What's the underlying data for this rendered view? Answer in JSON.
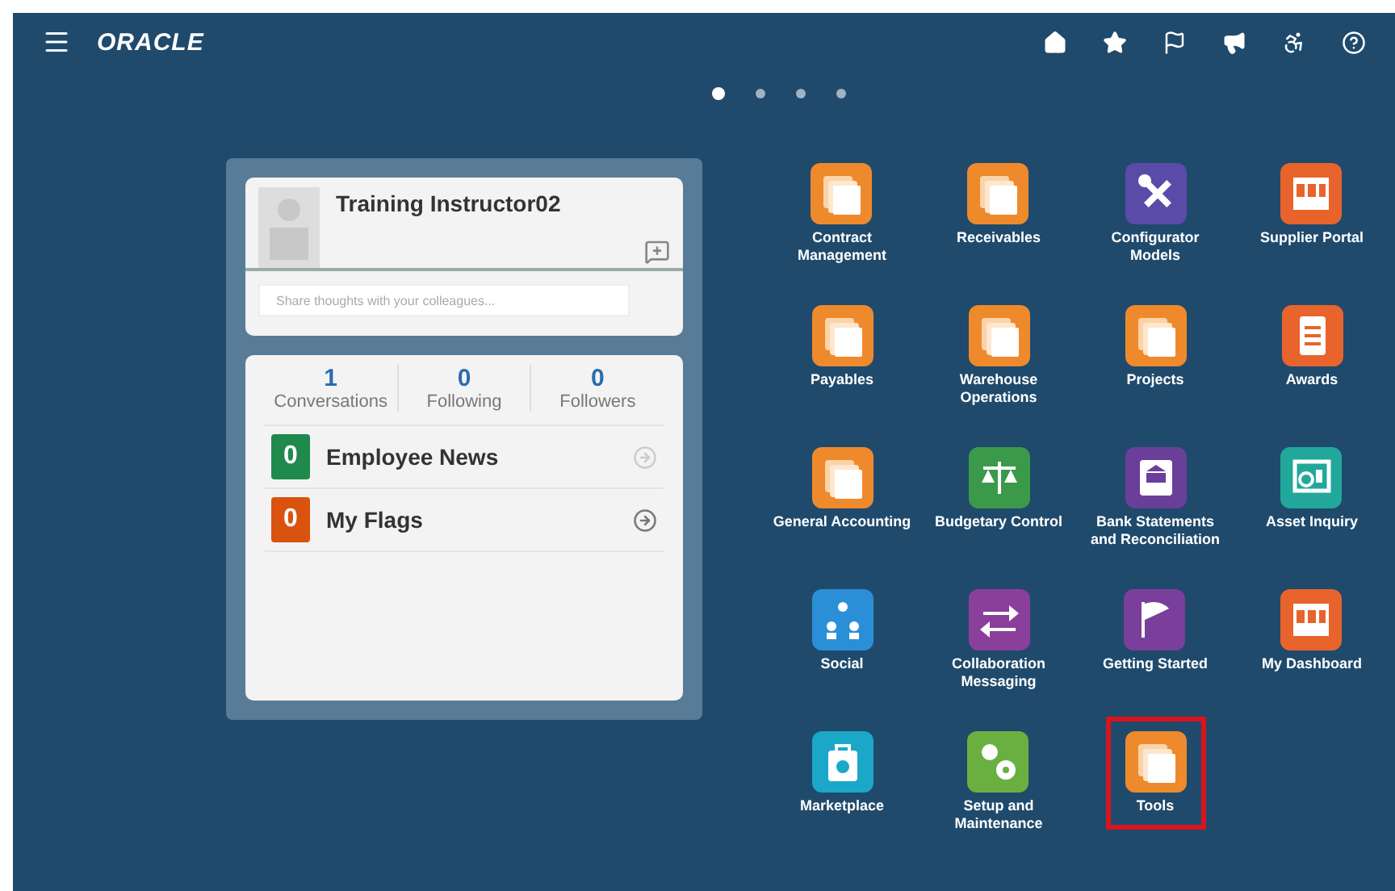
{
  "header": {
    "logo": "ORACLE"
  },
  "page_dots": [
    {
      "selected": true
    },
    {
      "selected": false
    },
    {
      "selected": false
    },
    {
      "selected": false
    }
  ],
  "profile": {
    "name": "Training Instructor02",
    "placeholder": "Share thoughts with your colleagues..."
  },
  "stats": [
    {
      "value": "1",
      "label": "Conversations"
    },
    {
      "value": "0",
      "label": "Following"
    },
    {
      "value": "0",
      "label": "Followers"
    }
  ],
  "feeds": [
    {
      "count": "0",
      "label": "Employee News",
      "color": "#1f8a4c",
      "disabled": true
    },
    {
      "count": "0",
      "label": "My Flags",
      "color": "#d9530f",
      "disabled": false
    }
  ],
  "apps": [
    {
      "label": "Contract\nManagement",
      "kind": "stack",
      "color": "#ee8a2c",
      "highlighted": false
    },
    {
      "label": "Receivables",
      "kind": "stack",
      "color": "#ee8a2c",
      "highlighted": false
    },
    {
      "label": "Configurator\nModels",
      "kind": "tools",
      "color": "#5b4ba8",
      "highlighted": false
    },
    {
      "label": "Supplier Portal",
      "kind": "dashboard",
      "color": "#e8642c",
      "highlighted": false
    },
    {
      "label": "Payables",
      "kind": "stack",
      "color": "#ee8a2c",
      "highlighted": false
    },
    {
      "label": "Warehouse\nOperations",
      "kind": "stack",
      "color": "#ee8a2c",
      "highlighted": false
    },
    {
      "label": "Projects",
      "kind": "stack",
      "color": "#ee8a2c",
      "highlighted": false
    },
    {
      "label": "Awards",
      "kind": "awards",
      "color": "#e8642c",
      "highlighted": false
    },
    {
      "label": "General Accounting",
      "kind": "stack",
      "color": "#ee8a2c",
      "highlighted": false
    },
    {
      "label": "Budgetary Control",
      "kind": "scales",
      "color": "#3a9a4a",
      "highlighted": false
    },
    {
      "label": "Bank Statements\nand Reconciliation",
      "kind": "bank",
      "color": "#6a3f9a",
      "highlighted": false
    },
    {
      "label": "Asset Inquiry",
      "kind": "inquiry",
      "color": "#21a89a",
      "highlighted": false
    },
    {
      "label": "Social",
      "kind": "social",
      "color": "#2b8fd8",
      "highlighted": false
    },
    {
      "label": "Collaboration\nMessaging",
      "kind": "arrows",
      "color": "#8a3f9a",
      "highlighted": false
    },
    {
      "label": "Getting Started",
      "kind": "flag",
      "color": "#7a3f9a",
      "highlighted": false
    },
    {
      "label": "My Dashboard",
      "kind": "dashboard",
      "color": "#e8642c",
      "highlighted": false
    },
    {
      "label": "Marketplace",
      "kind": "bag",
      "color": "#1ba8c8",
      "highlighted": false
    },
    {
      "label": "Setup and\nMaintenance",
      "kind": "gears",
      "color": "#6ab040",
      "highlighted": false
    },
    {
      "label": "Tools",
      "kind": "stack",
      "color": "#ee8a2c",
      "highlighted": true
    }
  ]
}
